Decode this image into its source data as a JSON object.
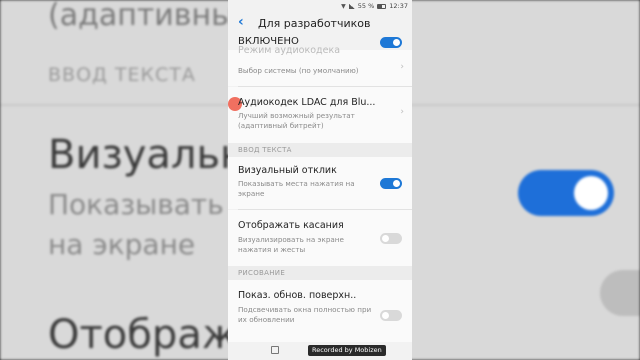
{
  "background": {
    "line1": "(адаптивный",
    "line2": "ВВОД ТЕКСТА",
    "line3": "Визуальный",
    "line4": "Показывать",
    "line5": "на экране",
    "line6": "Отобража"
  },
  "status_bar": {
    "battery": "55 %",
    "time": "12:37"
  },
  "app_bar": {
    "title": "Для разработчиков"
  },
  "master": {
    "label": "ВКЛЮЧЕНО",
    "on": true
  },
  "rows": {
    "codec_partial": {
      "subtitle": "Выбор системы (по умолчанию)"
    },
    "ldac": {
      "title": "Аудиокодек LDAC для Blu...",
      "subtitle": "Лучший возможный результат (адаптивный битрейт)"
    },
    "visual_feedback": {
      "title": "Визуальный отклик",
      "subtitle": "Показывать места нажатия на экране",
      "on": true
    },
    "show_touches": {
      "title": "Отображать касания",
      "subtitle": "Визуализировать на экране нажатия и жесты",
      "on": false
    },
    "surface_updates": {
      "title": "Показ. обнов. поверхн..",
      "subtitle": "Подсвечивать окна полностью при их обновлении",
      "on": false
    }
  },
  "sections": {
    "text_input": "ВВОД ТЕКСТА",
    "drawing": "РИСОВАНИЕ"
  },
  "watermark": "Recorded by Mobizen",
  "colors": {
    "accent": "#1e78d6",
    "background": "#f2f2f2",
    "toggle_off": "#d9d9d9"
  },
  "icons": [
    "back-arrow-icon",
    "chevron-right-icon",
    "wifi-icon",
    "signal-icon",
    "battery-icon",
    "home-icon"
  ]
}
